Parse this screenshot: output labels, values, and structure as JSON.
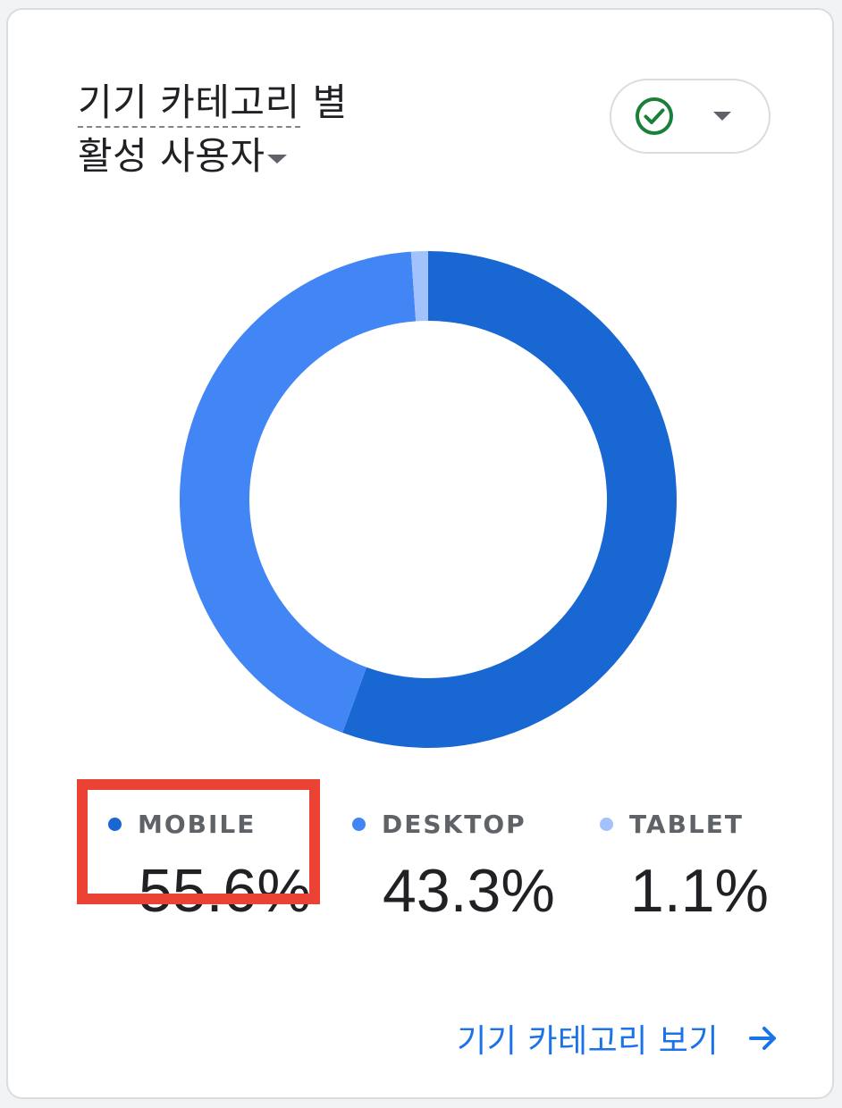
{
  "card": {
    "title_line1_underlined": "기기 카테고리",
    "title_line1_rest": " 별",
    "title_line2": "활성 사용자",
    "filter_icon": "check-circle-icon",
    "footer_link": "기기 카테고리 보기",
    "footer_icon": "arrow-right-icon"
  },
  "chart_data": {
    "type": "pie",
    "donut": true,
    "categories": [
      "MOBILE",
      "DESKTOP",
      "TABLET"
    ],
    "values": [
      55.6,
      43.3,
      1.1
    ],
    "value_labels": [
      "55.6%",
      "43.3%",
      "1.1%"
    ],
    "colors": [
      "#1967d2",
      "#4285f4",
      "#a1c2fa"
    ],
    "legend": "bottom"
  },
  "legend": [
    {
      "label": "MOBILE",
      "value": "55.6%",
      "color": "#1967d2"
    },
    {
      "label": "DESKTOP",
      "value": "43.3%",
      "color": "#4285f4"
    },
    {
      "label": "TABLET",
      "value": "1.1%",
      "color": "#a1c2fa"
    }
  ],
  "highlight": {
    "target": "MOBILE",
    "color": "#ea4335"
  }
}
